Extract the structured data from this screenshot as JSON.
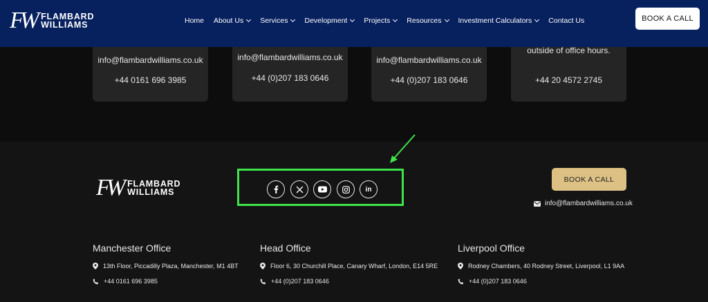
{
  "header": {
    "logo": {
      "mark": "FW",
      "line1": "FLAMBARD",
      "line2": "WILLIAMS"
    },
    "nav": [
      {
        "label": "Home",
        "dropdown": false
      },
      {
        "label": "About Us",
        "dropdown": true
      },
      {
        "label": "Services",
        "dropdown": true
      },
      {
        "label": "Development",
        "dropdown": true
      },
      {
        "label": "Projects",
        "dropdown": true
      },
      {
        "label": "Resources",
        "dropdown": true
      },
      {
        "label": "Investment Calculators",
        "dropdown": true
      },
      {
        "label": "Contact Us",
        "dropdown": false
      }
    ],
    "book_label": "BOOK A CALL"
  },
  "cards": [
    {
      "line1": "info@flambardwilliams.co.uk",
      "line2": "+44 0161 696 3985"
    },
    {
      "line1": "info@flambardwilliams.co.uk",
      "line2": "+44 (0)207 183 0646"
    },
    {
      "line1": "info@flambardwilliams.co.uk",
      "line2": "+44 (0)207 183 0646"
    },
    {
      "line1": "outside of office hours.",
      "line2": "+44 20 4572 2745"
    }
  ],
  "footer": {
    "logo": {
      "mark": "FW",
      "line1": "FLAMBARD",
      "line2": "WILLIAMS"
    },
    "social": [
      "facebook-icon",
      "x-icon",
      "youtube-icon",
      "instagram-icon",
      "linkedin-icon"
    ],
    "book_label": "BOOK A CALL",
    "email": "info@flambardwilliams.co.uk",
    "offices": [
      {
        "title": "Manchester Office",
        "address": "13th Floor, Piccadilly Plaza, Manchester, M1 4BT",
        "phone": "+44 0161 696 3985"
      },
      {
        "title": "Head Office",
        "address": "Floor 6, 30 Churchill Place, Canary Wharf, London, E14 5RE",
        "phone": "+44 (0)207 183 0646"
      },
      {
        "title": "Liverpool Office",
        "address": "Rodney Chambers, 40 Rodney Street, Liverpool, L1 9AA",
        "phone": "+44 (0)207 183 0646"
      }
    ]
  },
  "colors": {
    "header_bg": "#07205e",
    "highlight": "#3fe44a",
    "gold_button": "#dcc084",
    "card_bg": "#252525"
  }
}
